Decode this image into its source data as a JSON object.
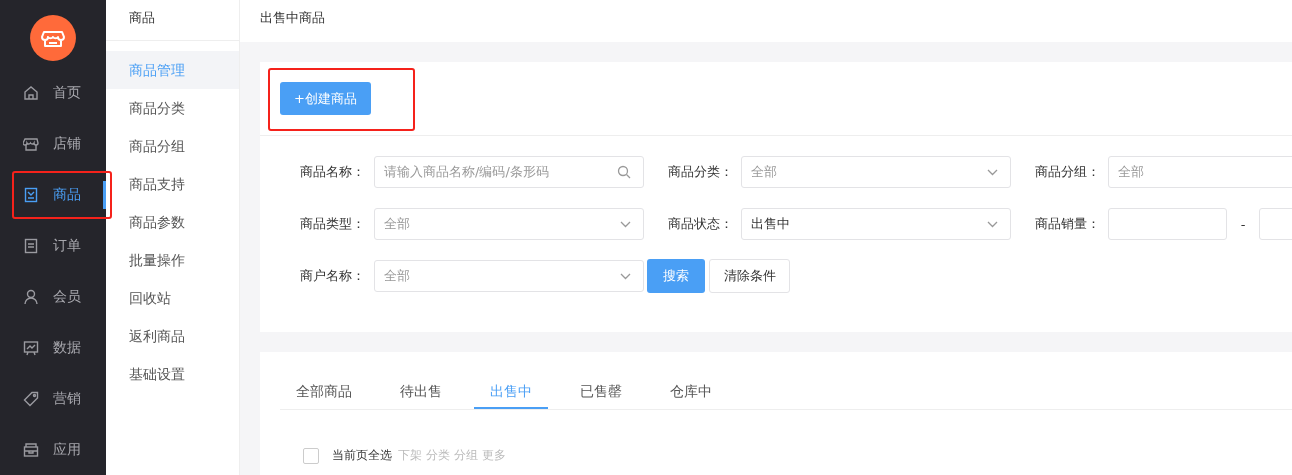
{
  "nav": {
    "items": [
      {
        "label": "首页",
        "selected": false,
        "highlighted": false
      },
      {
        "label": "店铺",
        "selected": false,
        "highlighted": false
      },
      {
        "label": "商品",
        "selected": true,
        "highlighted": true
      },
      {
        "label": "订单",
        "selected": false,
        "highlighted": false
      },
      {
        "label": "会员",
        "selected": false,
        "highlighted": false
      },
      {
        "label": "数据",
        "selected": false,
        "highlighted": false
      },
      {
        "label": "营销",
        "selected": false,
        "highlighted": false
      },
      {
        "label": "应用",
        "selected": false,
        "highlighted": false
      }
    ]
  },
  "subnav": {
    "title": "商品",
    "items": [
      {
        "label": "商品管理",
        "selected": true
      },
      {
        "label": "商品分类",
        "selected": false
      },
      {
        "label": "商品分组",
        "selected": false
      },
      {
        "label": "商品支持",
        "selected": false
      },
      {
        "label": "商品参数",
        "selected": false
      },
      {
        "label": "批量操作",
        "selected": false
      },
      {
        "label": "回收站",
        "selected": false
      },
      {
        "label": "返利商品",
        "selected": false
      },
      {
        "label": "基础设置",
        "selected": false
      }
    ]
  },
  "page_title": "出售中商品",
  "create_button": {
    "label": "+创建商品",
    "highlighted": true
  },
  "filter_rows": [
    [
      {
        "kind": "search",
        "label": "商品名称：",
        "placeholder": "请输入商品名称/编码/条形码"
      },
      {
        "kind": "select",
        "label": "商品分类：",
        "placeholder": "全部"
      },
      {
        "kind": "select",
        "label": "商品分组：",
        "placeholder": "全部"
      }
    ],
    [
      {
        "kind": "select",
        "label": "商品类型：",
        "placeholder": "全部"
      },
      {
        "kind": "select",
        "label": "商品状态：",
        "value": "出售中"
      },
      {
        "kind": "range",
        "label": "商品销量：",
        "separator": "-"
      }
    ],
    [
      {
        "kind": "select",
        "label": "商户名称：",
        "placeholder": "全部"
      },
      {
        "kind": "buttons",
        "buttons": [
          "搜索",
          "清除条件"
        ]
      }
    ]
  ],
  "tabs": [
    {
      "label": "全部商品",
      "selected": false
    },
    {
      "label": "待出售",
      "selected": false
    },
    {
      "label": "出售中",
      "selected": true
    },
    {
      "label": "已售罄",
      "selected": false
    },
    {
      "label": "仓库中",
      "selected": false
    }
  ],
  "bulk_bar": {
    "select_all": {
      "label": "当前页全选",
      "checked": false
    },
    "actions": [
      {
        "label": "下架",
        "disabled": true
      },
      {
        "label": "分类",
        "disabled": true
      },
      {
        "label": "分组",
        "disabled": true
      },
      {
        "label": "更多",
        "disabled": true
      }
    ]
  }
}
